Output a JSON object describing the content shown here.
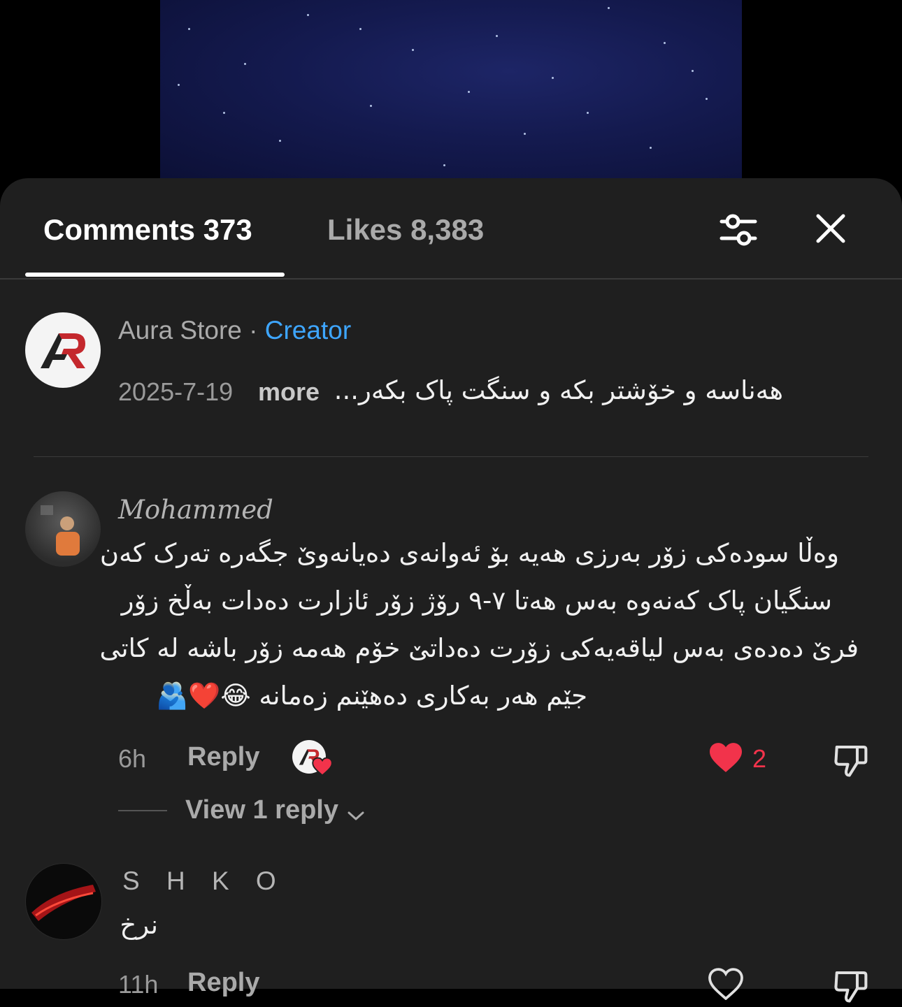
{
  "tabs": {
    "comments_label": "Comments 373",
    "likes_label": "Likes 8,383"
  },
  "icons": {
    "filter": "filter-sliders-icon",
    "close": "close-icon"
  },
  "pinned": {
    "author": "Aura Store",
    "separator": " · ",
    "badge": "Creator",
    "date": "2025-7-19",
    "more": "more",
    "text": "هەناسە و خۆشتر بکە و سنگت پاک بکەر..."
  },
  "comments": [
    {
      "author": "Mohammed",
      "lines": [
        "وەڵا سودەکی زۆر بەرزی هەیە بۆ ئەوانەی دەیانەوێ جگەرە تەرک کەن",
        "سنگیان پاک کەنەوە بەس هەتا ٧-٩ رۆژ زۆر ئازارت دەدات بەڵخ زۆر",
        "فرێ دەدەی بەس لیاقەیەکی زۆرت دەداتێ خۆم هەمە زۆر باشە لە کاتی",
        "جێم هەر بەکاری دەهێنم زەمانە 😂❤️🫂"
      ],
      "time": "6h",
      "reply_label": "Reply",
      "like_count": "2",
      "view_replies": "View 1 reply"
    },
    {
      "author": "S H K O",
      "lines": [
        "نرخ"
      ],
      "time": "11h",
      "reply_label": "Reply"
    }
  ],
  "colors": {
    "accent": "#3ea6ff",
    "heart": "#f2334b",
    "sheet_bg": "#1f1f1f"
  }
}
